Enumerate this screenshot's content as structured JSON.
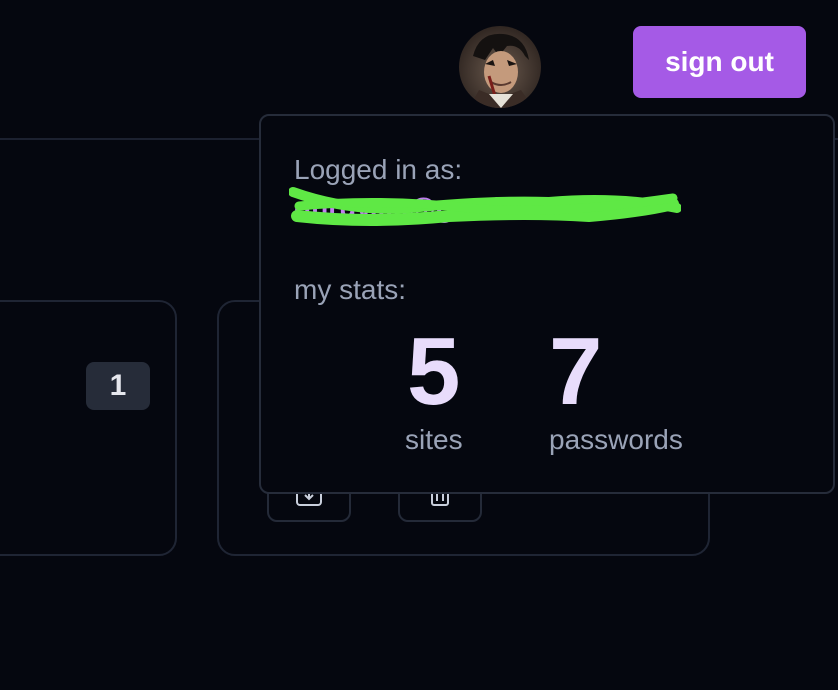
{
  "header": {
    "avatar_icon": "user-avatar-icon",
    "signout_label": "sign out",
    "accent_color": "#a55ae6"
  },
  "cards": {
    "count_badge": "1",
    "edit_icon": "edit-icon",
    "delete_icon": "trash-icon"
  },
  "profile_popover": {
    "logged_in_label": "Logged in as:",
    "email": "dhruv.....@gmail.com",
    "email_redacted": true,
    "stats_label": "my stats:",
    "stats": {
      "sites_value": "5",
      "sites_label": "sites",
      "passwords_value": "7",
      "passwords_label": "passwords"
    }
  }
}
